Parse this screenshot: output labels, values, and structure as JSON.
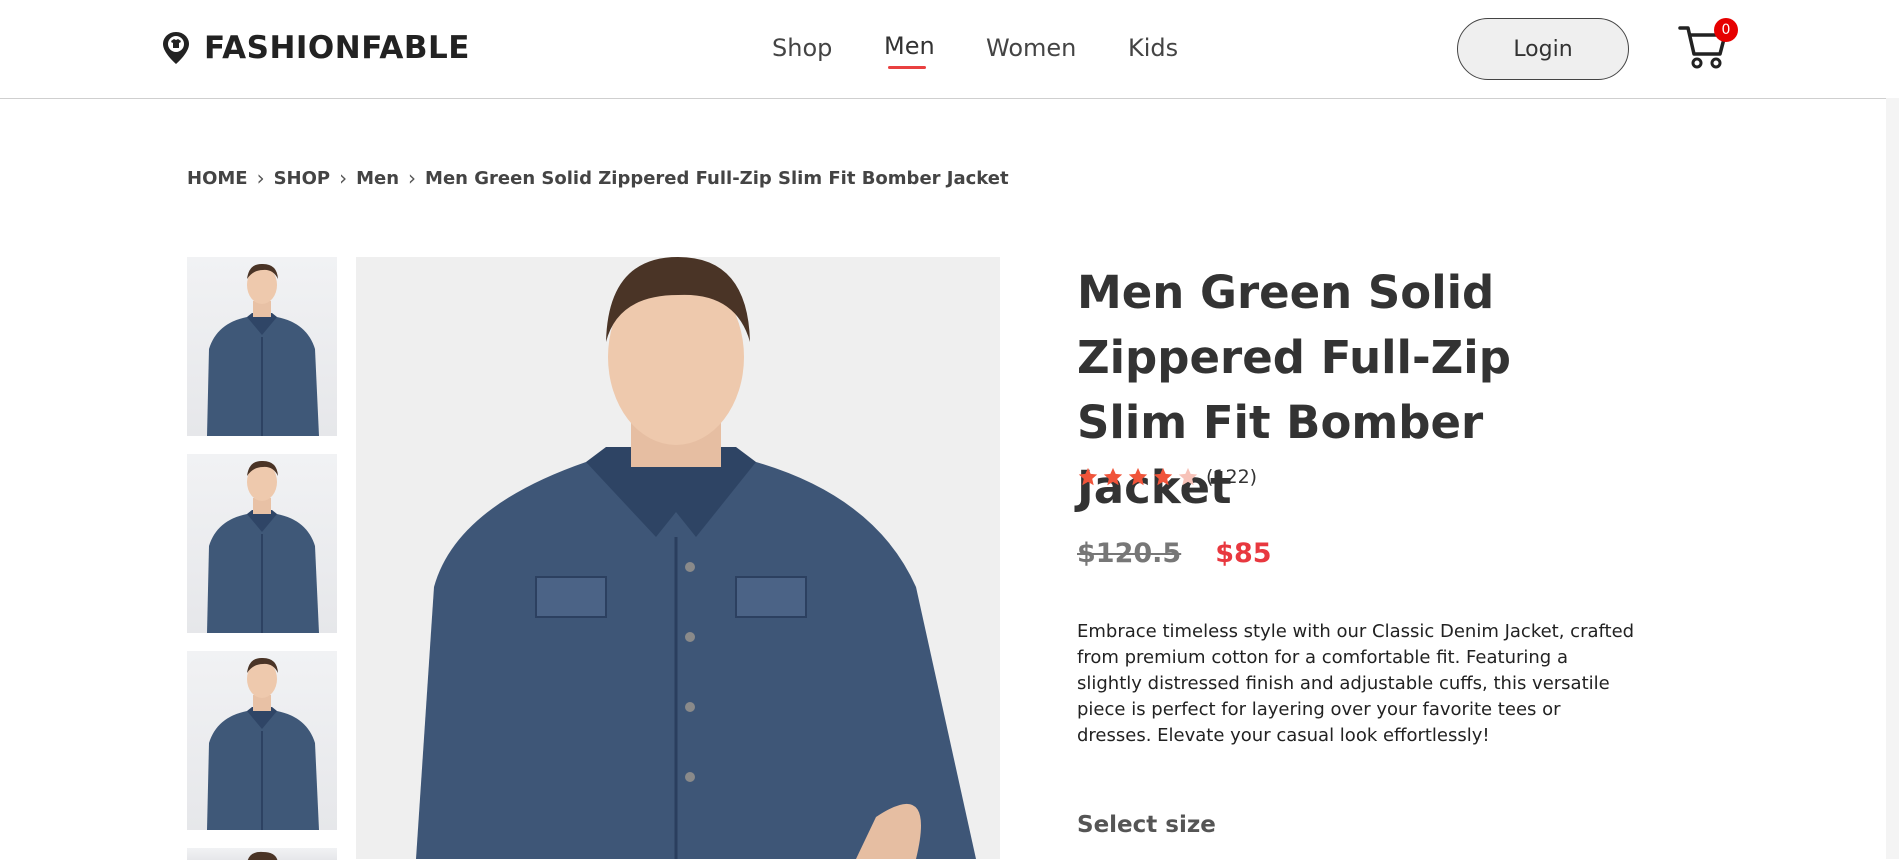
{
  "brand": {
    "name": "FASHIONFABLE"
  },
  "nav": {
    "items": [
      {
        "label": "Shop",
        "active": false
      },
      {
        "label": "Men",
        "active": true
      },
      {
        "label": "Women",
        "active": false
      },
      {
        "label": "Kids",
        "active": false
      }
    ],
    "active_color": "#e94040"
  },
  "header": {
    "login_label": "Login",
    "cart_count": "0"
  },
  "breadcrumb": {
    "items": [
      "HOME",
      "SHOP",
      "Men",
      "Men Green Solid Zippered Full-Zip Slim Fit Bomber Jacket"
    ]
  },
  "product": {
    "title": "Men Green Solid Zippered Full-Zip Slim Fit Bomber Jacket",
    "rating": 4,
    "rating_max": 5,
    "review_count": "(122)",
    "old_price": "$120.5",
    "price": "$85",
    "description": "Embrace timeless style with our Classic Denim Jacket, crafted from premium cotton for a comfortable fit. Featuring a slightly distressed finish and adjustable cuffs, this versatile piece is perfect for layering over your favorite tees or dresses. Elevate your casual look effortlessly!",
    "select_size_label": "Select size",
    "thumbnail_count": 4
  },
  "colors": {
    "accent": "#e8383f",
    "star": "#f0543a",
    "star_empty": "#f7c2b8"
  },
  "icons": {
    "logo": "location-pin-tshirt-icon",
    "cart": "shopping-cart-icon",
    "breadcrumb_separator": "chevron-right-icon"
  }
}
